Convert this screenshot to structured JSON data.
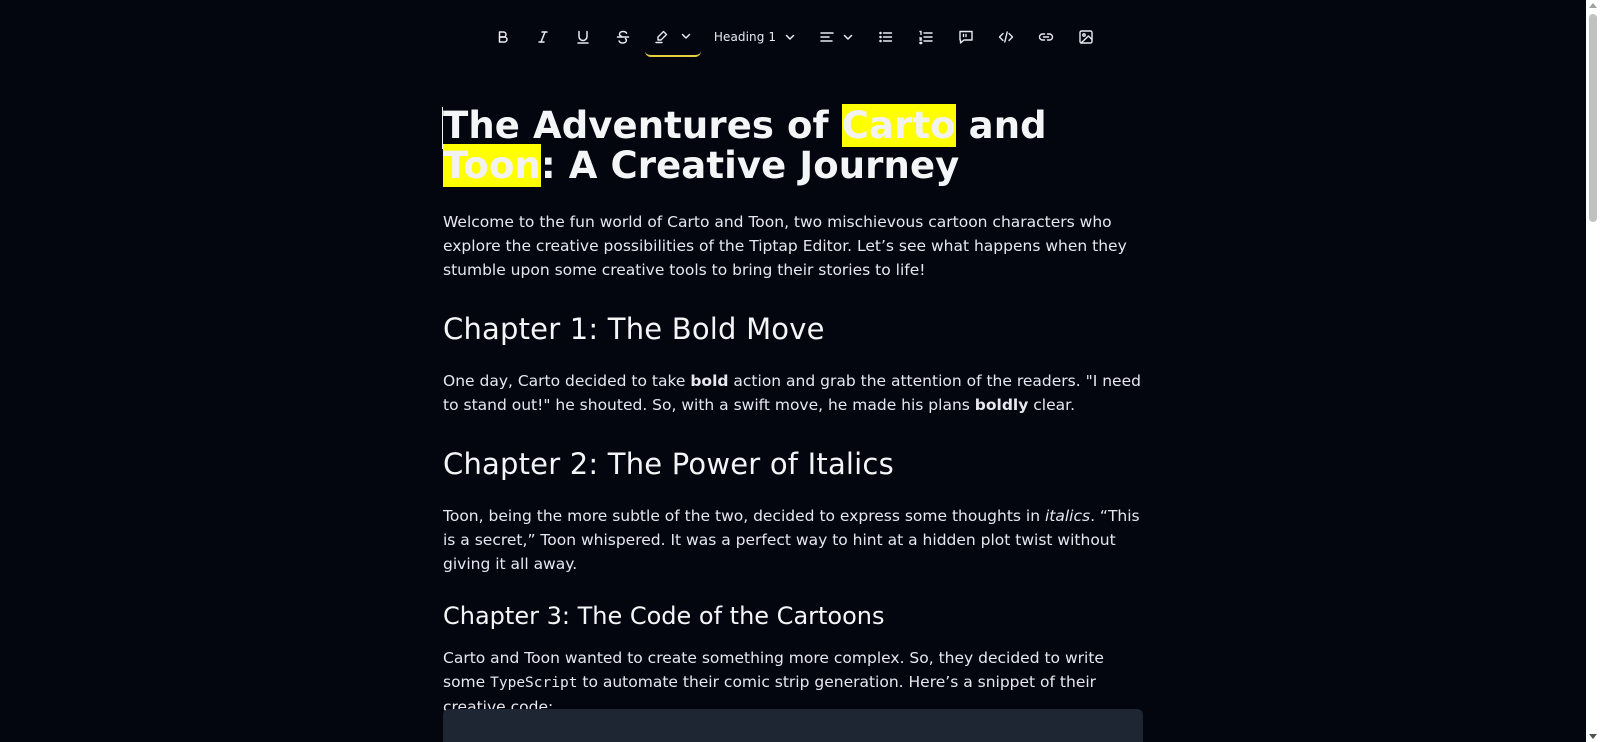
{
  "toolbar": {
    "heading_select": "Heading 1",
    "icons": [
      "bold-icon",
      "italic-icon",
      "underline-icon",
      "strikethrough-icon",
      "highlighter-icon",
      "align-left-icon",
      "bullet-list-icon",
      "ordered-list-icon",
      "blockquote-icon",
      "code-icon",
      "link-icon",
      "image-icon"
    ]
  },
  "colors": {
    "background": "#03060f",
    "highlight": "#ffff00",
    "highlight_underline": "#e5cf3a",
    "code_block": "#1e2633"
  },
  "document": {
    "title_part1": "The Adventures of ",
    "title_hl1": "Carto",
    "title_part2": " and ",
    "title_hl2": "Toon",
    "title_part3": ": A Creative Journey",
    "intro": "Welcome to the fun world of Carto and Toon, two mischievous cartoon characters who explore the creative possibilities of the Tiptap Editor. Let’s see what happens when they stumble upon some creative tools to bring their stories to life!",
    "ch1_title": "Chapter 1: The Bold Move",
    "ch1_p1": "One day, Carto decided to take ",
    "ch1_b1": "bold",
    "ch1_p2": " action and grab the attention of the readers. \"I need to stand out!\" he shouted. So, with a swift move, he made his plans ",
    "ch1_b2": "boldly",
    "ch1_p3": " clear.",
    "ch2_title": "Chapter 2: The Power of Italics",
    "ch2_p1": "Toon, being the more subtle of the two, decided to express some thoughts in ",
    "ch2_i1": "italics",
    "ch2_p2": ". “This is a secret,” Toon whispered. It was a perfect way to hint at a hidden plot twist without giving it all away.",
    "ch3_title": "Chapter 3: The Code of the Cartoons",
    "ch3_p1": "Carto and Toon wanted to create something more complex. So, they decided to write some ",
    "ch3_code": "TypeScript",
    "ch3_p2": " to automate their comic strip generation. Here’s a snippet of their creative code:"
  }
}
